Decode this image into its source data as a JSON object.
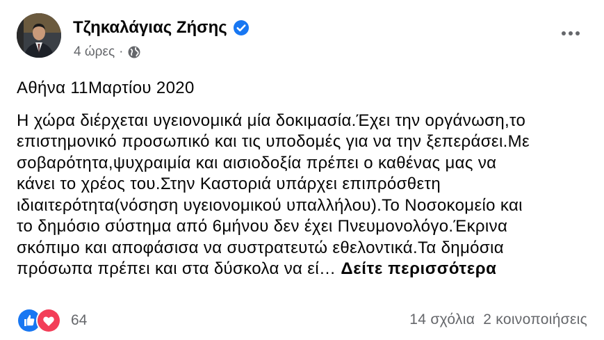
{
  "post": {
    "author": "Τζηκαλάγιας Ζήσης",
    "time": "4 ώρες",
    "separator": "·",
    "location_line": "Αθήνα 11Μαρτίου 2020",
    "text_lines": [
      "Η χώρα διέρχεται υγειονομικά μία δοκιμασία.Έχει την οργάνωση,το",
      "επιστημονικό προσωπικό και τις υποδομές για να την ξεπεράσει.Με",
      "σοβαρότητα,ψυχραιμία και αισιοδοξία πρέπει ο καθένας μας να",
      "κάνει το χρέος του.Στην Καστοριά υπάρχει επιπρόσθετη",
      "ιδιαιτερότητα(νόσηση υγειονομικού υπαλλήλου).Το Νοσοκομείο και",
      "το δημόσιο σύστημα από 6μήνου δεν έχει Πνευμονολόγο.Έκρινα",
      "σκόπιμο και αποφάσισα να συστρατευτώ εθελοντικά.Τα δημόσια",
      "πρόσωπα πρέπει και στα δύσκολα να εί…"
    ],
    "see_more": "Δείτε περισσότερα"
  },
  "footer": {
    "reaction_count": "64",
    "comments": "14 σχόλια",
    "shares": "2 κοινοποιήσεις"
  },
  "icons": {
    "verified": "verified-badge-icon",
    "audience": "globe-icon",
    "more": "more-options-icon",
    "like": "like-reaction-icon",
    "love": "love-reaction-icon"
  },
  "colors": {
    "verified": "#1877f2",
    "secondary_text": "#65676b",
    "like": "#1877f2",
    "love": "#f33e58"
  }
}
